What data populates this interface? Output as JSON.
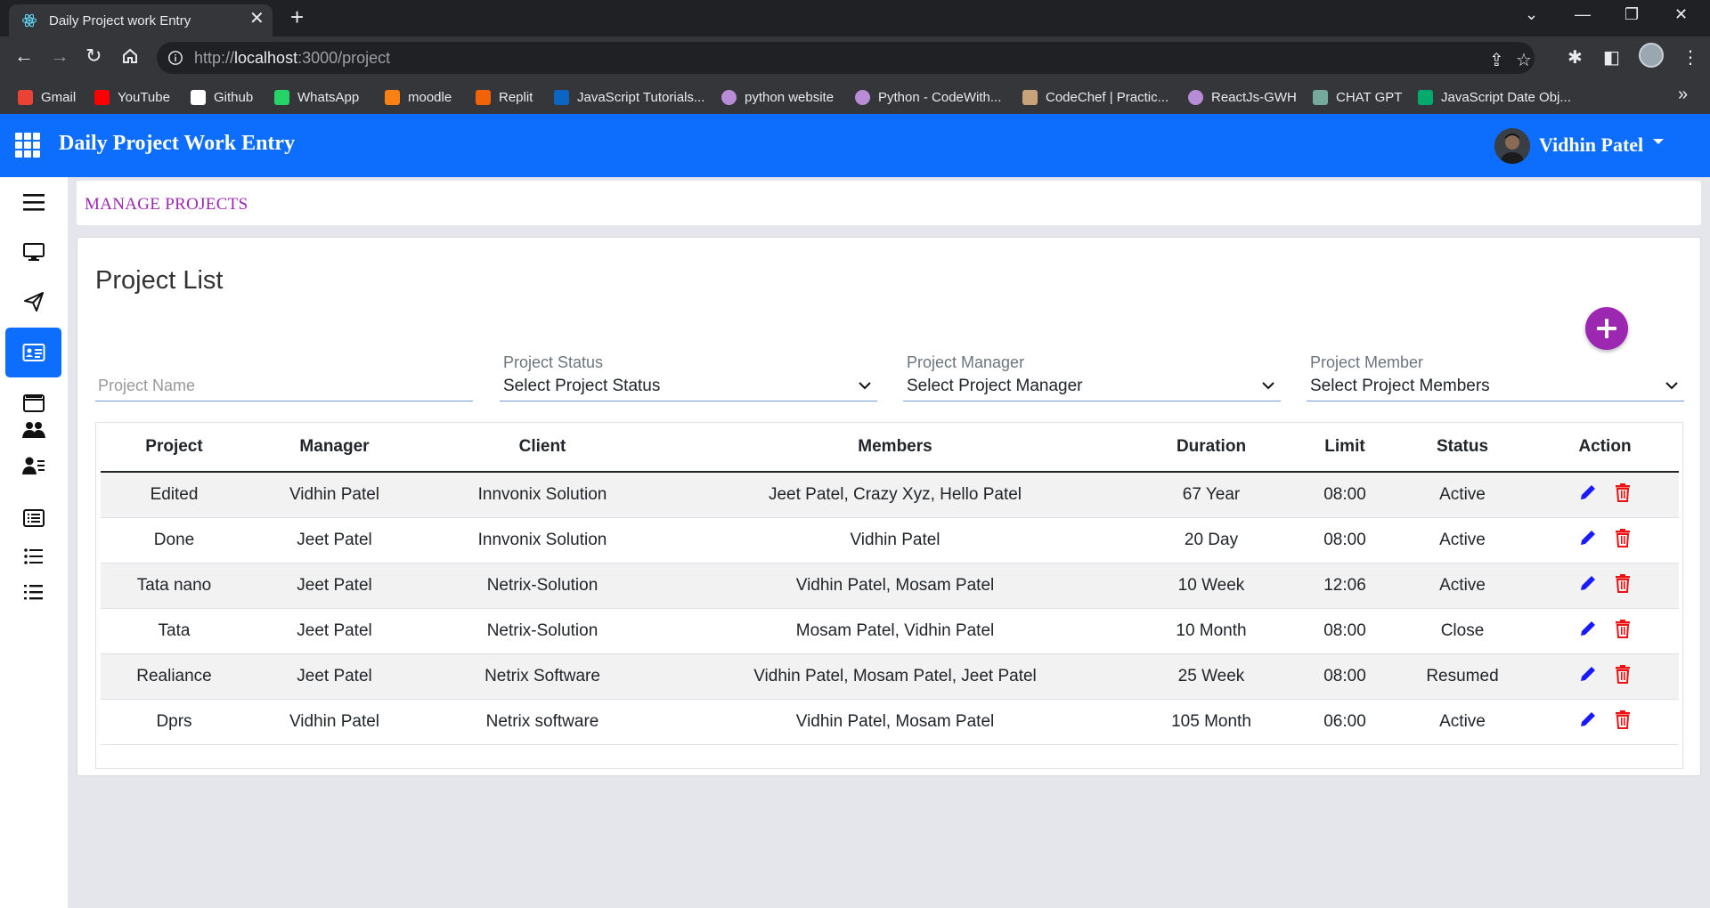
{
  "browser": {
    "tab_title": "Daily Project work Entry",
    "url_prefix": "http://",
    "url_host": "localhost",
    "url_path": ":3000/project",
    "bookmarks": [
      {
        "label": "Gmail",
        "color": "#ea4335"
      },
      {
        "label": "YouTube",
        "color": "#ff0000"
      },
      {
        "label": "Github",
        "color": "#ffffff"
      },
      {
        "label": "WhatsApp",
        "color": "#25d366"
      },
      {
        "label": "moodle",
        "color": "#f98012"
      },
      {
        "label": "Replit",
        "color": "#f26207"
      },
      {
        "label": "JavaScript Tutorials...",
        "color": "#0a66c2"
      },
      {
        "label": "python website",
        "color": "#b98cd8"
      },
      {
        "label": "Python - CodeWith...",
        "color": "#b98cd8"
      },
      {
        "label": "CodeChef | Practic...",
        "color": "#c8a37a"
      },
      {
        "label": "ReactJs-GWH",
        "color": "#b98cd8"
      },
      {
        "label": "CHAT GPT",
        "color": "#74aa9c"
      },
      {
        "label": "JavaScript Date Obj...",
        "color": "#04aa6d"
      }
    ]
  },
  "header": {
    "title": "Daily Project Work Entry",
    "user_name": "Vidhin Patel"
  },
  "sidebar": {
    "items": [
      "menu-icon",
      "monitor-icon",
      "send-icon",
      "id-card-icon",
      "window-icon",
      "users-icon",
      "user-list-icon",
      "list-box-icon",
      "list-icon",
      "list-alt-icon"
    ],
    "active_index": 3
  },
  "breadcrumb": "MANAGE PROJECTS",
  "page": {
    "title": "Project List",
    "filters": {
      "project_name_placeholder": "Project Name",
      "status_label": "Project Status",
      "status_value": "Select Project Status",
      "manager_label": "Project Manager",
      "manager_value": "Select Project Manager",
      "member_label": "Project Member",
      "member_value": "Select Project Members"
    }
  },
  "table": {
    "headers": [
      "Project",
      "Manager",
      "Client",
      "Members",
      "Duration",
      "Limit",
      "Status",
      "Action"
    ],
    "rows": [
      {
        "project": "Edited",
        "manager": "Vidhin Patel",
        "client": "Innvonix Solution",
        "members": "Jeet Patel, Crazy Xyz, Hello Patel",
        "duration": "67 Year",
        "limit": "08:00",
        "status": "Active"
      },
      {
        "project": "Done",
        "manager": "Jeet Patel",
        "client": "Innvonix Solution",
        "members": "Vidhin Patel",
        "duration": "20 Day",
        "limit": "08:00",
        "status": "Active"
      },
      {
        "project": "Tata nano",
        "manager": "Jeet Patel",
        "client": "Netrix-Solution",
        "members": "Vidhin Patel, Mosam Patel",
        "duration": "10 Week",
        "limit": "12:06",
        "status": "Active"
      },
      {
        "project": "Tata",
        "manager": "Jeet Patel",
        "client": "Netrix-Solution",
        "members": "Mosam Patel, Vidhin Patel",
        "duration": "10 Month",
        "limit": "08:00",
        "status": "Close"
      },
      {
        "project": "Realiance",
        "manager": "Jeet Patel",
        "client": "Netrix Software",
        "members": "Vidhin Patel, Mosam Patel, Jeet Patel",
        "duration": "25 Week",
        "limit": "08:00",
        "status": "Resumed"
      },
      {
        "project": "Dprs",
        "manager": "Vidhin Patel",
        "client": "Netrix software",
        "members": "Vidhin Patel, Mosam Patel",
        "duration": "105 Month",
        "limit": "06:00",
        "status": "Active"
      }
    ]
  },
  "colors": {
    "primary": "#0d6efd",
    "accent": "#9c27b0",
    "edit": "#1a1aff",
    "delete": "#ee1111"
  }
}
